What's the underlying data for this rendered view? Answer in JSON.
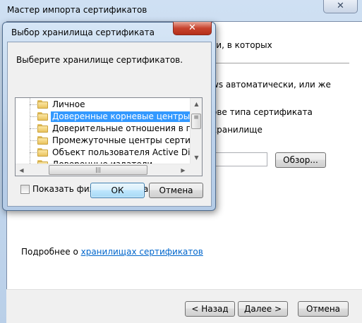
{
  "wizard": {
    "title": "Мастер импорта сертификатов",
    "close_glyph": "✕",
    "text_partial_1": "ги, в которых",
    "text_partial_2": "ws автоматически, или же",
    "text_partial_3": "ове типа сертификата",
    "text_partial_4": "хранилище",
    "browse_label": "Обзор...",
    "more_info_prefix": "Подробнее о ",
    "more_info_link": "хранилищах сертификатов",
    "back_label": "< Назад",
    "next_label": "Далее >",
    "cancel_label": "Отмена"
  },
  "dialog": {
    "title": "Выбор хранилища сертификата",
    "close_glyph": "✕",
    "instruction": "Выберите хранилище сертификатов.",
    "tree_items": [
      {
        "label": "Личное",
        "selected": false
      },
      {
        "label": "Доверенные корневые центры сертифи",
        "selected": true
      },
      {
        "label": "Доверительные отношения в предпри",
        "selected": false
      },
      {
        "label": "Промежуточные центры сертификаци",
        "selected": false
      },
      {
        "label": "Объект пользователя Active Directory",
        "selected": false
      },
      {
        "label": "Доверенные издатели",
        "selected": false
      }
    ],
    "show_physical_label": "Показать физические хранилища",
    "show_physical_checked": false,
    "ok_label": "ОК",
    "cancel_label": "Отмена"
  },
  "icons": {
    "scroll_up": "▲",
    "scroll_down": "▼",
    "scroll_left": "◀",
    "scroll_right": "▶",
    "grip_v": "≡",
    "grip_h": "|||"
  },
  "colors": {
    "selection": "#3399ff",
    "link": "#0066cc",
    "dialog_close": "#c7432e"
  }
}
